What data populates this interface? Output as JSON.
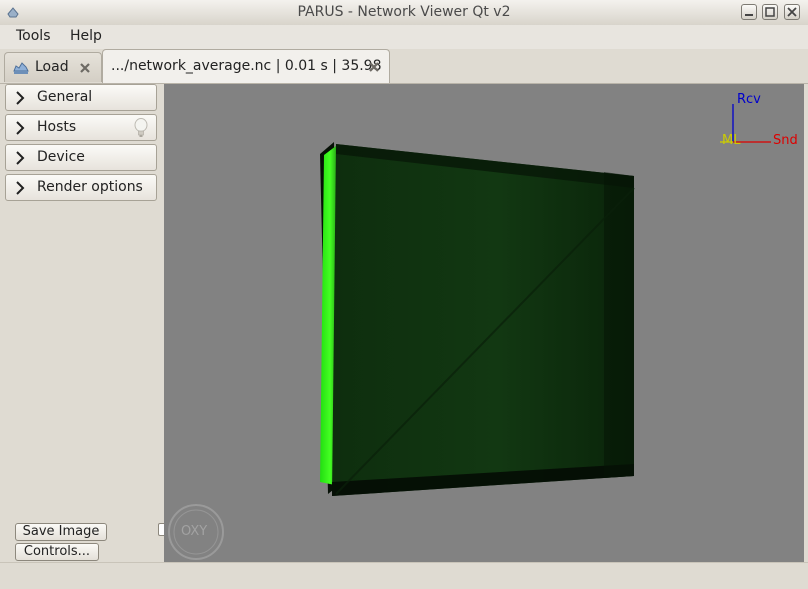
{
  "window": {
    "title": "PARUS - Network Viewer Qt v2"
  },
  "menu": {
    "items": [
      "Tools",
      "Help"
    ]
  },
  "tabs": [
    {
      "label": "Load"
    },
    {
      "label": ".../network_average.nc | 0.01 s | 35.98"
    }
  ],
  "sidebar": {
    "sections": [
      {
        "label": "General"
      },
      {
        "label": "Hosts"
      },
      {
        "label": "Device"
      },
      {
        "label": "Render options"
      }
    ],
    "save_image_label": "Save Image",
    "controls_label": "Controls..."
  },
  "viewport": {
    "background": "#828282",
    "axes": {
      "y_label": "Rcv",
      "x_label": "Snd",
      "z_label": "ML"
    },
    "axis_colors": {
      "y": "#0000cc",
      "x": "#dd0000",
      "z": "#cccc00"
    },
    "gizmo_label": "OXY"
  },
  "colors": {
    "accent_green": "#33ee22"
  }
}
